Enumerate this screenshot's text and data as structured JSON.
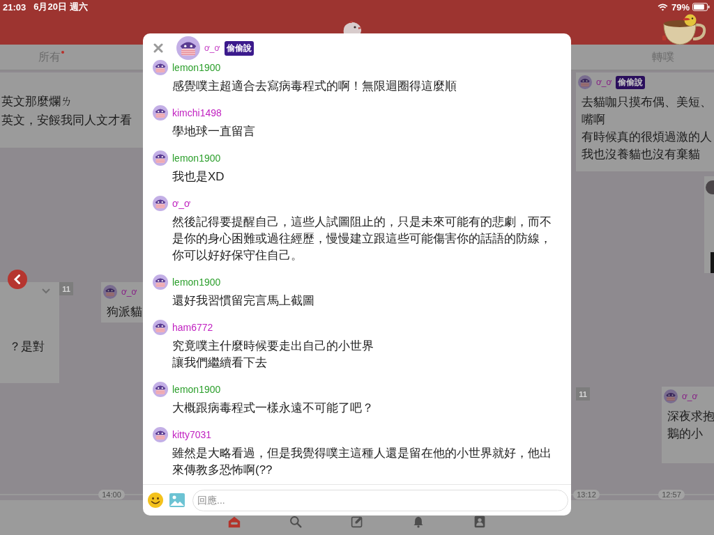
{
  "status_bar": {
    "time": "21:03",
    "date": "6月20日 週六",
    "battery": "79%"
  },
  "tabs": [
    {
      "label": "所有",
      "selected": false,
      "unread": true
    },
    {
      "label": "轉噗",
      "selected": false,
      "unread": false
    }
  ],
  "timeline": {
    "cards": [
      {
        "kind": "text",
        "lines": [
          "英文那麼爛ㄌ",
          "英文，安餒我同人文才看"
        ]
      },
      {
        "kind": "text",
        "lines": [
          "？是對"
        ]
      },
      {
        "kind": "text",
        "poster": {
          "name": "ơ_ơ"
        },
        "lines": [
          "狗派貓"
        ]
      },
      {
        "kind": "text",
        "poster": {
          "name": "ơ_ơ",
          "badge": "偷偷說"
        },
        "lines": [
          "去貓咖只摸布偶、美短、",
          "嘴啊",
          "有時候真的很煩過激的人",
          "我也沒養貓也沒有棄貓"
        ]
      },
      {
        "kind": "photo"
      },
      {
        "kind": "text",
        "poster": {
          "name": "ơ_ơ"
        },
        "lines": [
          "深夜求抱",
          "鵝的小"
        ]
      }
    ],
    "counts": [
      "11",
      "11"
    ],
    "times": [
      "14:00",
      "13:12",
      "12:57"
    ]
  },
  "bottom_nav": [
    {
      "selected": true
    },
    {
      "selected": false
    },
    {
      "selected": false
    },
    {
      "selected": false
    },
    {
      "selected": false
    }
  ],
  "dialog": {
    "poster": {
      "name": "ơ_ơ",
      "badge": "偷偷說"
    },
    "responses": [
      {
        "name": "lemon1900",
        "color": "#2a9e2a",
        "lines": [
          "感覺噗主超適合去寫病毒程式的啊！無限迴圈得這麼順"
        ]
      },
      {
        "name": "kimchi1498",
        "color": "#c01fc0",
        "lines": [
          "學地球一直留言"
        ]
      },
      {
        "name": "lemon1900",
        "color": "#2a9e2a",
        "lines": [
          "我也是XD"
        ]
      },
      {
        "name": "ơ_ơ",
        "color": "#c026c0",
        "lines": [
          "然後記得要提醒自己，這些人試圖阻止的，只是未來可能有的悲劇，而不是你的身心困難或過往經歷，慢慢建立跟這些可能傷害你的話語的防線，你可以好好保守住自己。"
        ]
      },
      {
        "name": "lemon1900",
        "color": "#2a9e2a",
        "lines": [
          "還好我習慣留完言馬上截圖"
        ]
      },
      {
        "name": "ham6772",
        "color": "#c01fc0",
        "lines": [
          "究竟噗主什麼時候要走出自己的小世界",
          "讓我們繼續看下去"
        ]
      },
      {
        "name": "lemon1900",
        "color": "#2a9e2a",
        "lines": [
          "大概跟病毒程式一樣永遠不可能了吧？"
        ]
      },
      {
        "name": "kitty7031",
        "color": "#c01fc0",
        "lines": [
          "雖然是大略看過，但是我覺得噗主這種人還是留在他的小世界就好，他出來傳教多恐怖啊(??"
        ]
      }
    ],
    "reply": {
      "placeholder": "回應..."
    }
  }
}
